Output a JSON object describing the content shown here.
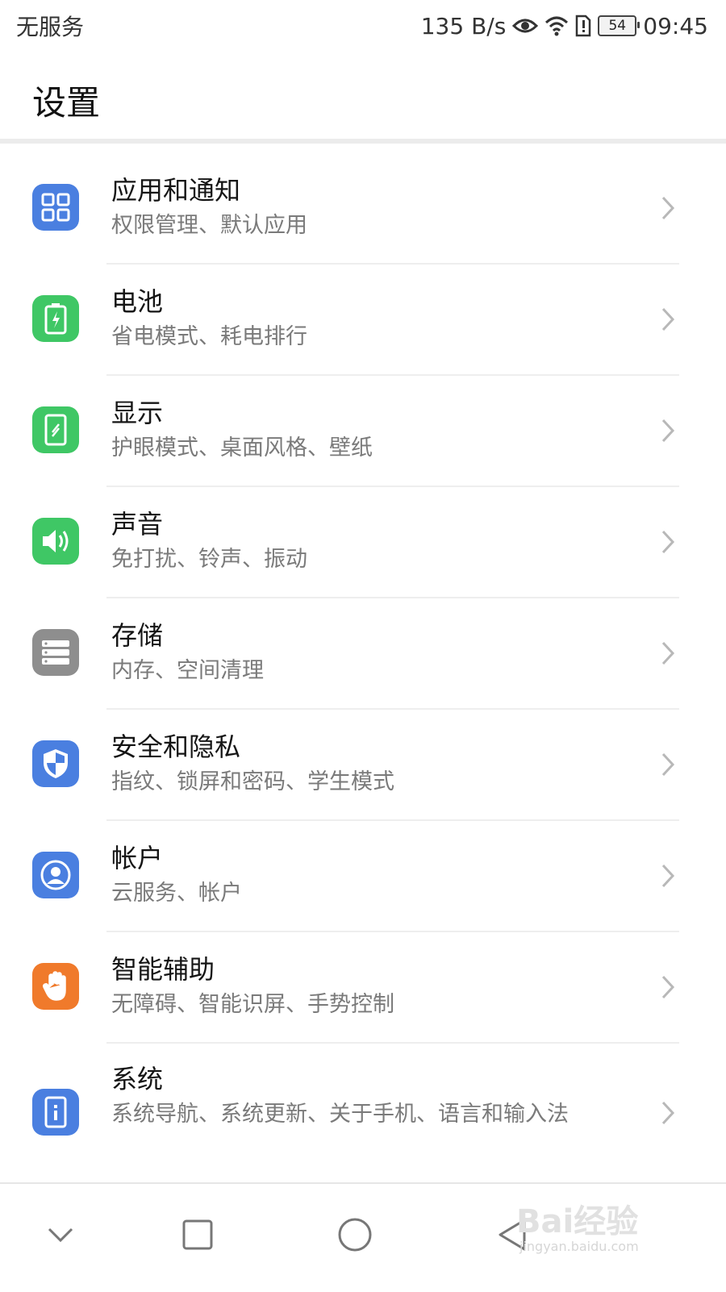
{
  "status_bar": {
    "carrier": "无服务",
    "net_speed": "135 B/s",
    "battery": "54",
    "time": "09:45",
    "icons": [
      "eye-comfort-icon",
      "wifi-icon",
      "sim-alert-icon",
      "battery-icon"
    ]
  },
  "header": {
    "title": "设置"
  },
  "settings": [
    {
      "title": "应用和通知",
      "subtitle": "权限管理、默认应用",
      "icon": "apps-grid-icon",
      "color": "#4a7fe0"
    },
    {
      "title": "电池",
      "subtitle": "省电模式、耗电排行",
      "icon": "battery-icon",
      "color": "#3fc765"
    },
    {
      "title": "显示",
      "subtitle": "护眼模式、桌面风格、壁纸",
      "icon": "display-icon",
      "color": "#3fc765"
    },
    {
      "title": "声音",
      "subtitle": "免打扰、铃声、振动",
      "icon": "speaker-icon",
      "color": "#3fc765"
    },
    {
      "title": "存储",
      "subtitle": "内存、空间清理",
      "icon": "storage-icon",
      "color": "#8e8e8e"
    },
    {
      "title": "安全和隐私",
      "subtitle": "指纹、锁屏和密码、学生模式",
      "icon": "shield-icon",
      "color": "#4a7fe0"
    },
    {
      "title": "帐户",
      "subtitle": "云服务、帐户",
      "icon": "account-icon",
      "color": "#4a7fe0"
    },
    {
      "title": "智能辅助",
      "subtitle": "无障碍、智能识屏、手势控制",
      "icon": "hand-icon",
      "color": "#f07a2b"
    },
    {
      "title": "系统",
      "subtitle": "系统导航、系统更新、关于手机、语言和输入法",
      "icon": "system-info-icon",
      "color": "#4a7fe0"
    }
  ],
  "nav_bar": {
    "buttons": [
      "hide-navbar-icon",
      "recents-icon",
      "home-icon",
      "back-icon"
    ]
  },
  "watermark": {
    "brand": "Bai经验",
    "url": "jingyan.baidu.com"
  }
}
